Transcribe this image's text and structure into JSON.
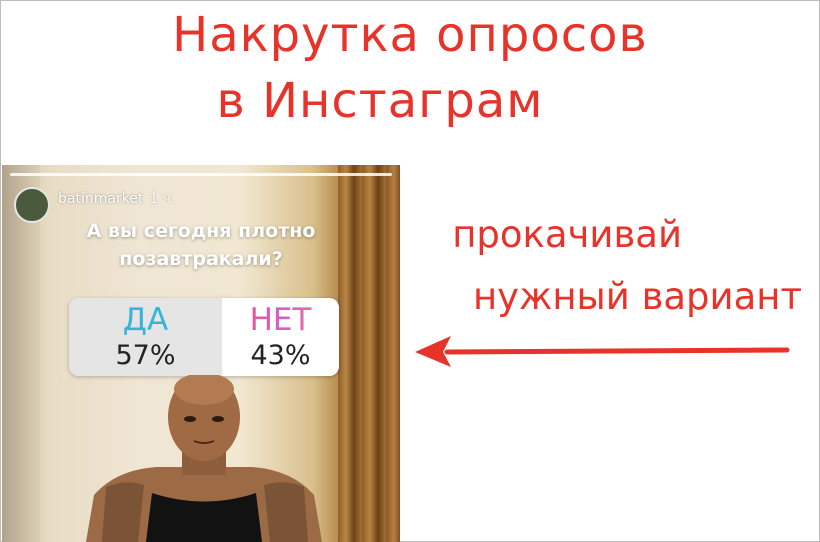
{
  "headline": {
    "line1": "Накрутка опросов",
    "line2": "в Инстаграм"
  },
  "tagline": {
    "line1": "прокачивай",
    "line2": "нужный вариант"
  },
  "story": {
    "username": "batinmarket",
    "time": "1 ч",
    "question_line1": "А вы сегодня плотно",
    "question_line2": "позавтракали?",
    "poll": {
      "options": [
        {
          "label": "ДА",
          "percent": "57%"
        },
        {
          "label": "НЕТ",
          "percent": "43%"
        }
      ]
    }
  },
  "colors": {
    "accent": "#e8332a",
    "yes": "#36b6d6",
    "no": "#f5506a"
  },
  "icons": {
    "arrow": "left-arrow-icon"
  }
}
